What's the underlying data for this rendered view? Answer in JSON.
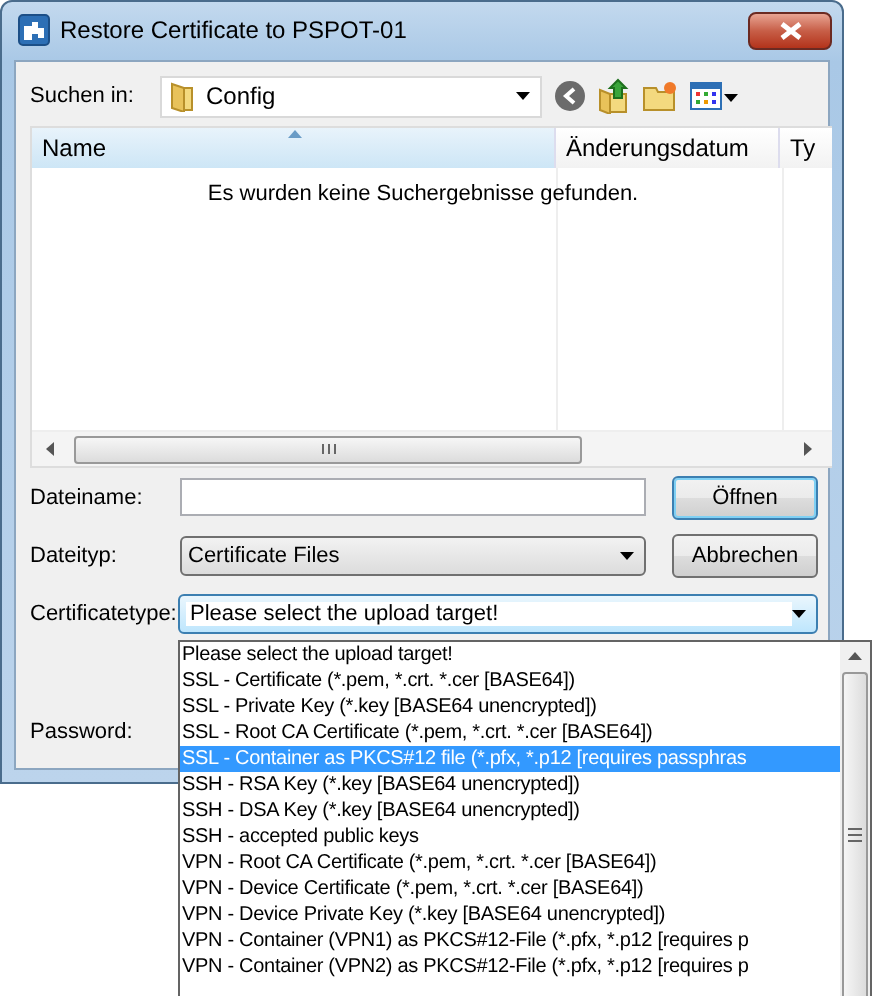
{
  "window": {
    "title": "Restore Certificate to PSPOT-01"
  },
  "toolbar": {
    "label": "Suchen in:",
    "location": "Config"
  },
  "file_list": {
    "columns": [
      {
        "label": "Name",
        "sorted": true
      },
      {
        "label": "Änderungsdatum",
        "sorted": false
      },
      {
        "label": "Ty",
        "sorted": false
      }
    ],
    "empty_message": "Es wurden keine Suchergebnisse gefunden."
  },
  "fields": [
    {
      "kind": "text",
      "label": "Dateiname:",
      "focused": false
    },
    {
      "kind": "combo",
      "label": "Dateityp:",
      "value": "Certificate Files",
      "focused": false
    },
    {
      "kind": "combo",
      "label": "Certificatetype:",
      "value": "Please select the upload target!",
      "focused": true
    },
    {
      "kind": "password",
      "label": "Password:",
      "focused": false
    }
  ],
  "buttons": [
    {
      "label": "Öffnen",
      "default": true
    },
    {
      "label": "Abbrechen",
      "default": false
    }
  ],
  "dropdown": {
    "items": [
      {
        "label": "Please select the upload target!",
        "selected": false
      },
      {
        "label": "SSL - Certificate (*.pem, *.crt. *.cer [BASE64])",
        "selected": false
      },
      {
        "label": "SSL - Private Key (*.key [BASE64 unencrypted])",
        "selected": false
      },
      {
        "label": "SSL - Root CA Certificate (*.pem, *.crt. *.cer [BASE64])",
        "selected": false
      },
      {
        "label": "SSL - Container as PKCS#12 file (*.pfx, *.p12 [requires passphras",
        "selected": true
      },
      {
        "label": "SSH - RSA Key (*.key [BASE64 unencrypted])",
        "selected": false
      },
      {
        "label": "SSH - DSA Key (*.key [BASE64 unencrypted])",
        "selected": false
      },
      {
        "label": "SSH - accepted public keys",
        "selected": false
      },
      {
        "label": "VPN - Root CA Certificate (*.pem, *.crt. *.cer [BASE64])",
        "selected": false
      },
      {
        "label": "VPN - Device Certificate (*.pem, *.crt. *.cer [BASE64])",
        "selected": false
      },
      {
        "label": "VPN - Device Private Key (*.key [BASE64 unencrypted])",
        "selected": false
      },
      {
        "label": "VPN - Container (VPN1) as PKCS#12-File (*.pfx, *.p12 [requires p",
        "selected": false
      },
      {
        "label": "VPN - Container (VPN2) as PKCS#12-File (*.pfx, *.p12 [requires p",
        "selected": false
      }
    ]
  }
}
